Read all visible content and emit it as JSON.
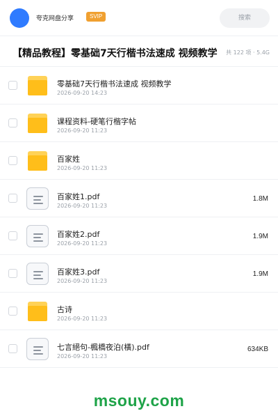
{
  "header": {
    "app_name": "夸克网盘分享",
    "badge": "SVIP",
    "search_placeholder": "搜索",
    "avatar_color": "#2f7bff"
  },
  "folder": {
    "title": "【精品教程】零基础7天行楷书法速成 视频教学",
    "meta": "共 122 项 · 5.4G"
  },
  "files": [
    {
      "name": "零基础7天行楷书法速成 视频教学",
      "date": "2026-09-20 14:23",
      "size": "",
      "type": "folder"
    },
    {
      "name": "课程资料-硬笔行楷字帖",
      "date": "2026-09-20 11:23",
      "size": "",
      "type": "folder"
    },
    {
      "name": "百家姓",
      "date": "2026-09-20 11:23",
      "size": "",
      "type": "folder"
    },
    {
      "name": "百家姓1.pdf",
      "date": "2026-09-20 11:23",
      "size": "1.8M",
      "type": "doc"
    },
    {
      "name": "百家姓2.pdf",
      "date": "2026-09-20 11:23",
      "size": "1.9M",
      "type": "doc"
    },
    {
      "name": "百家姓3.pdf",
      "date": "2026-09-20 11:23",
      "size": "1.9M",
      "type": "doc"
    },
    {
      "name": "古诗",
      "date": "2026-09-20 11:23",
      "size": "",
      "type": "folder"
    },
    {
      "name": "七言絕句-楓橋夜泊(橫).pdf",
      "date": "2026-09-20 11:23",
      "size": "634KB",
      "type": "doc"
    }
  ],
  "watermark": "msouy.com",
  "colors": {
    "folder": "#ffbe1a",
    "badge": "#f0a030",
    "watermark": "#1ea348"
  }
}
